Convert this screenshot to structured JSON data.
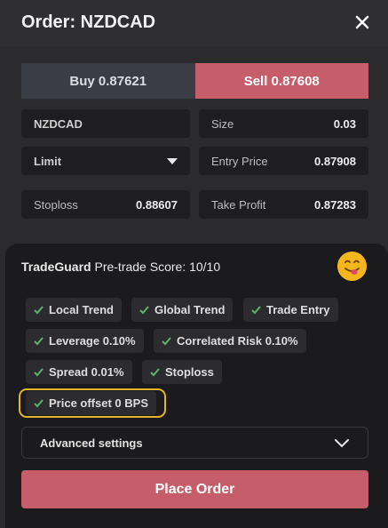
{
  "header": {
    "title": "Order: NZDCAD"
  },
  "side": {
    "buy_label": "Buy 0.87621",
    "sell_label": "Sell 0.87608"
  },
  "form": {
    "symbol": "NZDCAD",
    "size_label": "Size",
    "size_value": "0.03",
    "order_type": "Limit",
    "entry_label": "Entry Price",
    "entry_value": "0.87908",
    "stoploss_label": "Stoploss",
    "stoploss_value": "0.88607",
    "tp_label": "Take Profit",
    "tp_value": "0.87283"
  },
  "guard": {
    "brand": "TradeGuard",
    "score_label": "Pre-trade Score:",
    "score_value": "10/10",
    "emoji": "smiling-face-tongue-icon",
    "checks": [
      "Local Trend",
      "Global Trend",
      "Trade Entry",
      "Leverage 0.10%",
      "Correlated Risk 0.10%",
      "Spread 0.01%",
      "Stoploss",
      "Price offset 0 BPS"
    ]
  },
  "advanced": {
    "label": "Advanced settings"
  },
  "actions": {
    "place_label": "Place Order"
  },
  "colors": {
    "sell": "#c55e6a",
    "check": "#5ab56a",
    "highlight": "#e4b42c",
    "background": "#2b2b2e"
  }
}
